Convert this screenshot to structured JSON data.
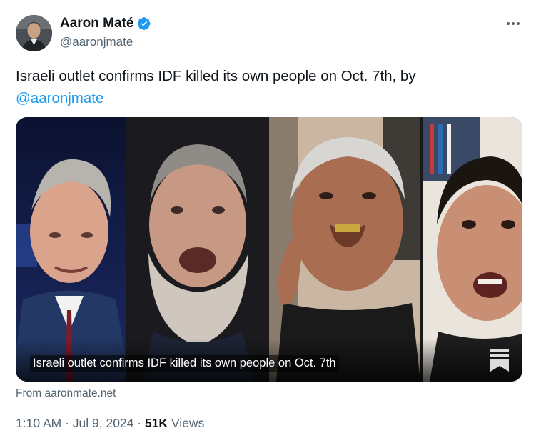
{
  "author": {
    "name": "Aaron Maté",
    "handle": "@aaronjmate"
  },
  "tweet": {
    "text": "Israeli outlet confirms IDF killed its own people on Oct. 7th, by",
    "mention": "@aaronjmate"
  },
  "card": {
    "caption": "Israeli outlet confirms IDF killed its own people on Oct. 7th",
    "source": "From aaronmate.net"
  },
  "meta": {
    "time": "1:10 AM",
    "date": "Jul 9, 2024",
    "views_count": "51K",
    "views_label": "Views"
  },
  "colors": {
    "link": "#1d9bf0",
    "verified": "#1d9bf0",
    "muted": "#536471",
    "text": "#0f1419"
  },
  "icons": {
    "verified": "verified-badge-icon",
    "more": "more-options-icon",
    "card_overlay": "bookmark-article-icon"
  }
}
